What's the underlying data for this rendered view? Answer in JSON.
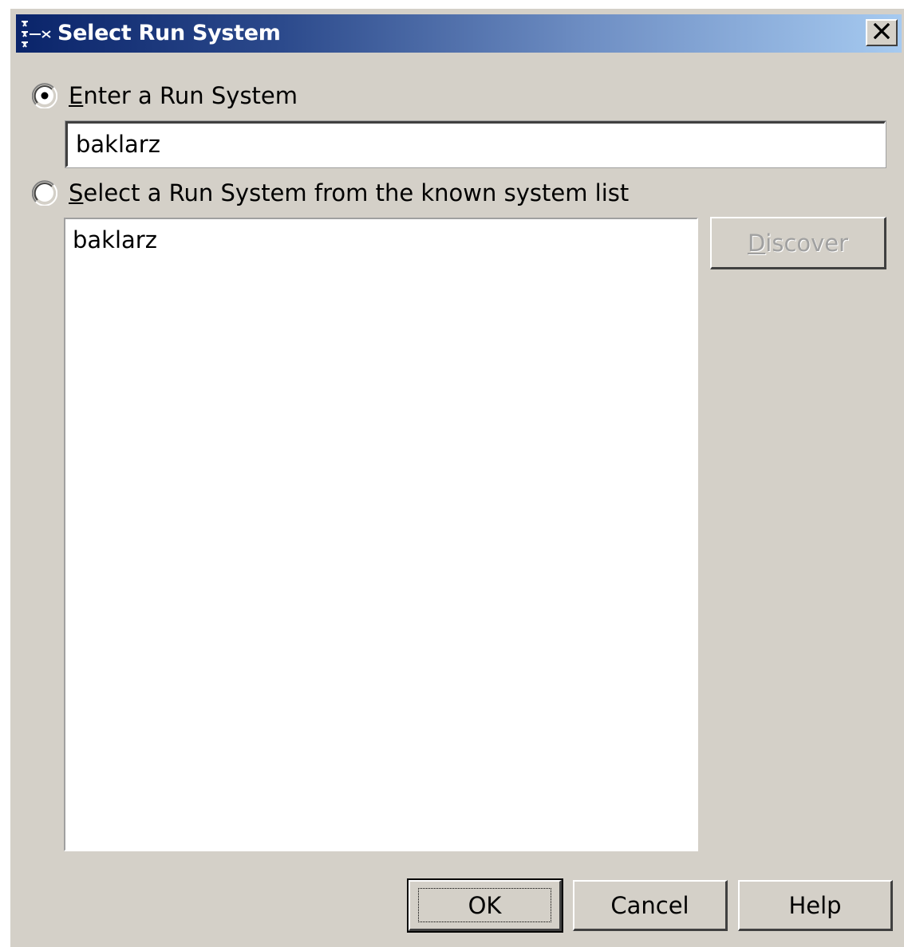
{
  "window": {
    "title": "Select Run System",
    "close_symbol": "✕"
  },
  "options": {
    "enter": {
      "label_first": "E",
      "label_rest": "nter a Run System",
      "selected": true
    },
    "select": {
      "label_first": "S",
      "label_rest": "elect a Run System from the known system list",
      "selected": false
    }
  },
  "run_system_input": {
    "value": "baklarz"
  },
  "known_systems": {
    "items": [
      "baklarz"
    ]
  },
  "buttons": {
    "discover_first": "D",
    "discover_rest": "iscover",
    "ok": "OK",
    "cancel": "Cancel",
    "help": "Help"
  }
}
